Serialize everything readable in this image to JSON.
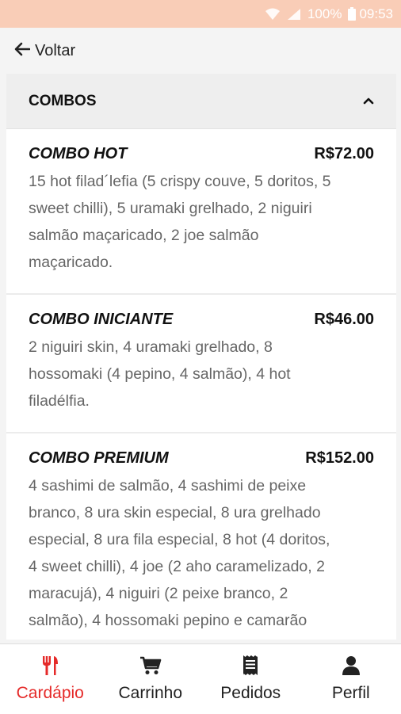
{
  "status_bar": {
    "battery": "100%",
    "time": "09:53",
    "icons": [
      "wifi-icon",
      "signal-icon",
      "battery-icon"
    ]
  },
  "nav": {
    "back_label": "Voltar",
    "icon": "arrow-left-icon"
  },
  "section": {
    "title": "COMBOS",
    "icon": "chevron-up-icon",
    "expanded": true
  },
  "items": [
    {
      "name": "COMBO HOT",
      "price": "R$72.00",
      "description": "15 hot filad´lefia (5 crispy couve, 5 doritos, 5 sweet chilli), 5 uramaki grelhado, 2 niguiri salmão maçaricado, 2 joe salmão maçaricado."
    },
    {
      "name": "COMBO INICIANTE",
      "price": "R$46.00",
      "description": "2 niguiri skin, 4 uramaki grelhado, 8 hossomaki (4 pepino, 4 salmão), 4 hot filadélfia."
    },
    {
      "name": "COMBO PREMIUM",
      "price": "R$152.00",
      "description": "4 sashimi de salmão, 4 sashimi de peixe branco, 8 ura skin especial, 8 ura grelhado especial, 8 ura fila especial, 8 hot (4 doritos, 4 sweet chilli), 4 joe (2 aho caramelizado, 2 maracujá), 4 niguiri (2 peixe branco, 2 salmão), 4 hossomaki pepino e camarão"
    }
  ],
  "tabs": [
    {
      "label": "Cardápio",
      "icon": "utensils-icon",
      "active": true
    },
    {
      "label": "Carrinho",
      "icon": "cart-icon",
      "active": false
    },
    {
      "label": "Pedidos",
      "icon": "receipt-icon",
      "active": false
    },
    {
      "label": "Perfil",
      "icon": "user-icon",
      "active": false
    }
  ],
  "colors": {
    "status_bar": "#f9cdb7",
    "accent": "#e52a29",
    "text": "#111111",
    "muted_text": "#666666"
  }
}
